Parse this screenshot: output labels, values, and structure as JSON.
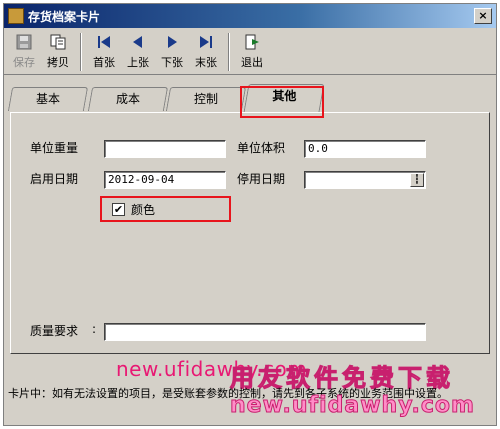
{
  "window": {
    "title": "存货档案卡片",
    "close": "×"
  },
  "toolbar": {
    "save": "保存",
    "copy": "拷贝",
    "first": "首张",
    "prev": "上张",
    "next": "下张",
    "last": "末张",
    "exit": "退出"
  },
  "tabs": [
    "基本",
    "成本",
    "控制",
    "其他"
  ],
  "active_tab": "其他",
  "form": {
    "unit_weight_label": "单位重量",
    "unit_weight_value": "",
    "unit_volume_label": "单位体积",
    "unit_volume_value": "0.0",
    "start_date_label": "启用日期",
    "start_date_value": "2012-09-04",
    "stop_date_label": "停用日期",
    "stop_date_value": "",
    "color_label": "颜色",
    "color_checked": true,
    "color_check_mark": "✔",
    "quality_label": "质量要求",
    "quality_value": ""
  },
  "status": {
    "text": "卡片中：如有无法设置的项目，是受账套参数的控制，请先到各子系统的业务范围中设置。"
  },
  "watermark": {
    "url_top": "new.ufidawhy.com",
    "brand": "用友软件免费下载",
    "url_bottom": "new.ufidawhy.com"
  },
  "colors": {
    "highlight": "#e8141c",
    "watermark": "#e81873"
  }
}
